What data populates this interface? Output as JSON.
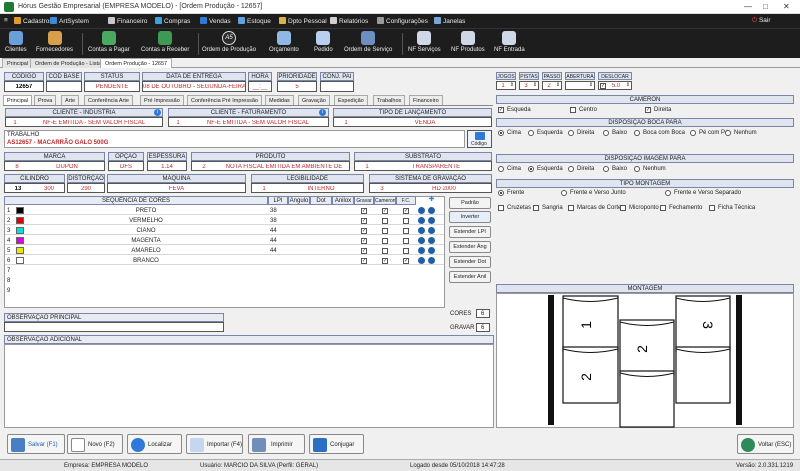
{
  "window": {
    "title": "Hórus Gestão Empresarial (EMPRESA MODELO) - [Ordem Produção - 12657]"
  },
  "menu": {
    "items": [
      "Cadastros",
      "ArtSystem",
      "Financeiro",
      "Compras",
      "Vendas",
      "Estoque",
      "Dpto Pessoal",
      "Relatórios",
      "Configurações",
      "Janelas"
    ],
    "sair": "Sair"
  },
  "toolbar": {
    "items": [
      "Clientes",
      "Fornecedores",
      "Contas a Pagar",
      "Contas a Receber",
      "Ordem de Produção",
      "Orçamento",
      "Pedido",
      "Ordem de Serviço",
      "NF Serviços",
      "NF Produtos",
      "NF Entrada"
    ],
    "a5_label": "A5"
  },
  "doc_tabs": [
    "Principal",
    "Ordem de Produção - Lista",
    "Ordem Produção - 12657"
  ],
  "header": {
    "codigo_label": "CÓDIGO",
    "codigo": "12657",
    "cod_base_label": "COD BASE",
    "cod_base": "",
    "status_label": "STATUS",
    "status": "PENDENTE",
    "data_entrega_label": "DATA DE ENTREGA",
    "data_entrega": "08 DE OUTUBRO - SEGUNDA-FEIRA",
    "hora_label": "HORA",
    "hora": "__:__",
    "prioridade_label": "PRIORIDADE",
    "prioridade": "5",
    "conj_pai_label": "CONJ. PAI",
    "conj_pai": ""
  },
  "sub_tabs": [
    "Principal",
    "Prova",
    "Arte",
    "Conferência Arte",
    "Pré Impressão",
    "Conferência Pré Impressão",
    "Medidas",
    "Gravação",
    "Expedição",
    "Trabalhos",
    "Financeiro"
  ],
  "cliente_industria": {
    "label": "CLIENTE - INDÚSTRIA",
    "code": "1",
    "name": "NF-E EMITIDA - SEM VALOR FISCAL"
  },
  "cliente_faturamento": {
    "label": "CLIENTE - FATURAMENTO",
    "code": "1",
    "name": "NF-E EMITIDA - SEM VALOR FISCAL"
  },
  "tipo_lancamento": {
    "label": "TIPO DE LANÇAMENTO",
    "code": "1",
    "name": "VENDA"
  },
  "trabalho": {
    "label": "TRABALHO",
    "value": "AS12657 - MACARRÃO GALO 500G",
    "btn": "Código"
  },
  "marca": {
    "label": "MARCA",
    "code": "8",
    "name": "DUPON"
  },
  "opcao": {
    "label": "OPÇÃO",
    "value": "DFS"
  },
  "espessura": {
    "label": "ESPESSURA",
    "value": "1.14"
  },
  "produto": {
    "label": "PRODUTO",
    "code": "2",
    "name": "NOTA FISCAL EMITIDA EM AMBIENTE DE"
  },
  "substrato": {
    "label": "SUBSTRATO",
    "code": "1",
    "name": "TRANSPARENTE"
  },
  "cilindro": {
    "label": "CILINDRO",
    "code": "13",
    "value": "300"
  },
  "distorcao": {
    "label": "DISTORÇÃO",
    "value": "290"
  },
  "maquina": {
    "label": "MÁQUINA",
    "name": "FEVA"
  },
  "legibilidade": {
    "label": "LEGIBILIDADE",
    "code": "1",
    "name": "INTERNO"
  },
  "sistema_gravacao": {
    "label": "SISTEMA DE GRAVAÇÃO",
    "code": "3",
    "name": "HD 2000"
  },
  "cores": {
    "title": "SEQUÊNCIA DE CORES",
    "cols": [
      "LPI",
      "Ângulo",
      "Dot",
      "Anilox",
      "Gravar",
      "Cameron",
      "F.C."
    ],
    "rows": [
      {
        "n": "1",
        "color": "#000000",
        "name": "PRETO",
        "lpi": "38"
      },
      {
        "n": "2",
        "color": "#e00000",
        "name": "VERMELHO",
        "lpi": "38"
      },
      {
        "n": "3",
        "color": "#00e0e0",
        "name": "CIANO",
        "lpi": "44"
      },
      {
        "n": "4",
        "color": "#e000e0",
        "name": "MAGENTA",
        "lpi": "44"
      },
      {
        "n": "5",
        "color": "#f2e600",
        "name": "AMARELO",
        "lpi": "44"
      },
      {
        "n": "6",
        "color": "#ffffff",
        "name": "BRANCO",
        "lpi": ""
      }
    ],
    "empty_rows": [
      "7",
      "8",
      "9"
    ]
  },
  "side_buttons": [
    "Padrão",
    "Inverter",
    "Estender LPI",
    "Estender Âng",
    "Estender Dot",
    "Estender Anil"
  ],
  "cores_count": {
    "label": "CORES",
    "value": "6"
  },
  "gravar_count": {
    "label": "GRAVAR",
    "value": "6"
  },
  "obs_principal": {
    "label": "OBSERVAÇÃO PRINCIPAL",
    "value": ""
  },
  "obs_adicional": {
    "label": "OBSERVAÇÃO ADICIONAL",
    "value": ""
  },
  "montagem_top": {
    "jogos": {
      "label": "JOGOS",
      "value": "1"
    },
    "pistas": {
      "label": "PISTAS",
      "value": "3"
    },
    "passo": {
      "label": "PASSO",
      "value": "2"
    },
    "abertura": {
      "label": "ABERTURA",
      "value": ""
    },
    "deslocar": {
      "label": "DESLOCAR",
      "value": "5.0"
    }
  },
  "cameron": {
    "title": "CAMERON",
    "options": [
      "Esqueda",
      "Centro",
      "Direita"
    ]
  },
  "boca": {
    "title": "DISPOSIÇÃO BOCA PARA",
    "options": [
      "Cima",
      "Esquerda",
      "Direita",
      "Baixo",
      "Boca com Boca",
      "Pé com Pé",
      "Nenhum"
    ]
  },
  "imagem": {
    "title": "DISPOSIÇÃO IMAGEM PARA",
    "options": [
      "Cima",
      "Esquerda",
      "Direita",
      "Baixo",
      "Nenhum"
    ]
  },
  "tipo_montagem": {
    "title": "TIPO MONTAGEM",
    "options": [
      "Frente",
      "Frente e Verso Junto",
      "Frente e Verso Separado"
    ]
  },
  "montagem_checks": [
    "Cruzetas",
    "Sangria",
    "Marcas de Corte",
    "Microponto",
    "Fechamento",
    "Ficha Técnica"
  ],
  "montagem": {
    "title": "MONTAGEM",
    "labels": [
      "1",
      "2",
      "3",
      "2"
    ]
  },
  "bottom_buttons": [
    "Salvar (F1)",
    "Novo (F2)",
    "Localizar",
    "Importar (F4)",
    "Imprimir",
    "Conjugar",
    "Voltar (ESC)"
  ],
  "status": {
    "empresa": "Empresa: EMPRESA MODELO",
    "usuario": "Usuário: MARCIO DA SILVA (Perfil: GERAL)",
    "logado": "Logado desde 05/10/2018 14:47:28",
    "versao": "Versão: 2.0.331.1219"
  }
}
